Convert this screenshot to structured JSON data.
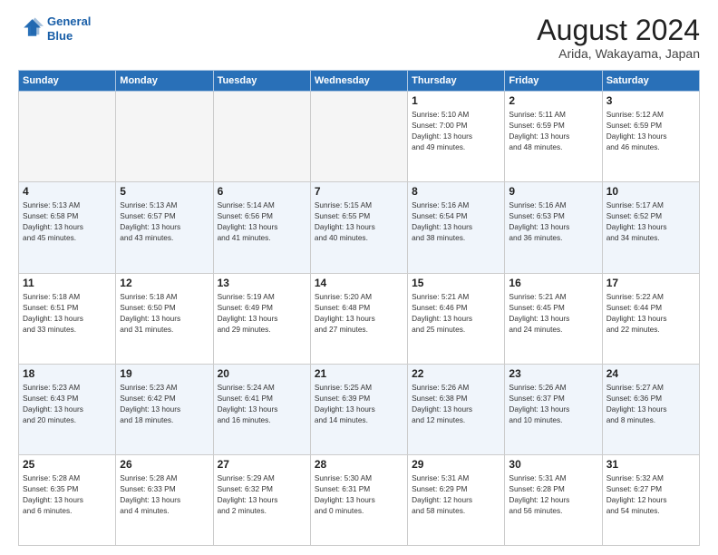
{
  "header": {
    "logo_line1": "General",
    "logo_line2": "Blue",
    "title": "August 2024",
    "subtitle": "Arida, Wakayama, Japan"
  },
  "weekdays": [
    "Sunday",
    "Monday",
    "Tuesday",
    "Wednesday",
    "Thursday",
    "Friday",
    "Saturday"
  ],
  "weeks": [
    [
      {
        "day": "",
        "info": ""
      },
      {
        "day": "",
        "info": ""
      },
      {
        "day": "",
        "info": ""
      },
      {
        "day": "",
        "info": ""
      },
      {
        "day": "1",
        "info": "Sunrise: 5:10 AM\nSunset: 7:00 PM\nDaylight: 13 hours\nand 49 minutes."
      },
      {
        "day": "2",
        "info": "Sunrise: 5:11 AM\nSunset: 6:59 PM\nDaylight: 13 hours\nand 48 minutes."
      },
      {
        "day": "3",
        "info": "Sunrise: 5:12 AM\nSunset: 6:59 PM\nDaylight: 13 hours\nand 46 minutes."
      }
    ],
    [
      {
        "day": "4",
        "info": "Sunrise: 5:13 AM\nSunset: 6:58 PM\nDaylight: 13 hours\nand 45 minutes."
      },
      {
        "day": "5",
        "info": "Sunrise: 5:13 AM\nSunset: 6:57 PM\nDaylight: 13 hours\nand 43 minutes."
      },
      {
        "day": "6",
        "info": "Sunrise: 5:14 AM\nSunset: 6:56 PM\nDaylight: 13 hours\nand 41 minutes."
      },
      {
        "day": "7",
        "info": "Sunrise: 5:15 AM\nSunset: 6:55 PM\nDaylight: 13 hours\nand 40 minutes."
      },
      {
        "day": "8",
        "info": "Sunrise: 5:16 AM\nSunset: 6:54 PM\nDaylight: 13 hours\nand 38 minutes."
      },
      {
        "day": "9",
        "info": "Sunrise: 5:16 AM\nSunset: 6:53 PM\nDaylight: 13 hours\nand 36 minutes."
      },
      {
        "day": "10",
        "info": "Sunrise: 5:17 AM\nSunset: 6:52 PM\nDaylight: 13 hours\nand 34 minutes."
      }
    ],
    [
      {
        "day": "11",
        "info": "Sunrise: 5:18 AM\nSunset: 6:51 PM\nDaylight: 13 hours\nand 33 minutes."
      },
      {
        "day": "12",
        "info": "Sunrise: 5:18 AM\nSunset: 6:50 PM\nDaylight: 13 hours\nand 31 minutes."
      },
      {
        "day": "13",
        "info": "Sunrise: 5:19 AM\nSunset: 6:49 PM\nDaylight: 13 hours\nand 29 minutes."
      },
      {
        "day": "14",
        "info": "Sunrise: 5:20 AM\nSunset: 6:48 PM\nDaylight: 13 hours\nand 27 minutes."
      },
      {
        "day": "15",
        "info": "Sunrise: 5:21 AM\nSunset: 6:46 PM\nDaylight: 13 hours\nand 25 minutes."
      },
      {
        "day": "16",
        "info": "Sunrise: 5:21 AM\nSunset: 6:45 PM\nDaylight: 13 hours\nand 24 minutes."
      },
      {
        "day": "17",
        "info": "Sunrise: 5:22 AM\nSunset: 6:44 PM\nDaylight: 13 hours\nand 22 minutes."
      }
    ],
    [
      {
        "day": "18",
        "info": "Sunrise: 5:23 AM\nSunset: 6:43 PM\nDaylight: 13 hours\nand 20 minutes."
      },
      {
        "day": "19",
        "info": "Sunrise: 5:23 AM\nSunset: 6:42 PM\nDaylight: 13 hours\nand 18 minutes."
      },
      {
        "day": "20",
        "info": "Sunrise: 5:24 AM\nSunset: 6:41 PM\nDaylight: 13 hours\nand 16 minutes."
      },
      {
        "day": "21",
        "info": "Sunrise: 5:25 AM\nSunset: 6:39 PM\nDaylight: 13 hours\nand 14 minutes."
      },
      {
        "day": "22",
        "info": "Sunrise: 5:26 AM\nSunset: 6:38 PM\nDaylight: 13 hours\nand 12 minutes."
      },
      {
        "day": "23",
        "info": "Sunrise: 5:26 AM\nSunset: 6:37 PM\nDaylight: 13 hours\nand 10 minutes."
      },
      {
        "day": "24",
        "info": "Sunrise: 5:27 AM\nSunset: 6:36 PM\nDaylight: 13 hours\nand 8 minutes."
      }
    ],
    [
      {
        "day": "25",
        "info": "Sunrise: 5:28 AM\nSunset: 6:35 PM\nDaylight: 13 hours\nand 6 minutes."
      },
      {
        "day": "26",
        "info": "Sunrise: 5:28 AM\nSunset: 6:33 PM\nDaylight: 13 hours\nand 4 minutes."
      },
      {
        "day": "27",
        "info": "Sunrise: 5:29 AM\nSunset: 6:32 PM\nDaylight: 13 hours\nand 2 minutes."
      },
      {
        "day": "28",
        "info": "Sunrise: 5:30 AM\nSunset: 6:31 PM\nDaylight: 13 hours\nand 0 minutes."
      },
      {
        "day": "29",
        "info": "Sunrise: 5:31 AM\nSunset: 6:29 PM\nDaylight: 12 hours\nand 58 minutes."
      },
      {
        "day": "30",
        "info": "Sunrise: 5:31 AM\nSunset: 6:28 PM\nDaylight: 12 hours\nand 56 minutes."
      },
      {
        "day": "31",
        "info": "Sunrise: 5:32 AM\nSunset: 6:27 PM\nDaylight: 12 hours\nand 54 minutes."
      }
    ]
  ]
}
